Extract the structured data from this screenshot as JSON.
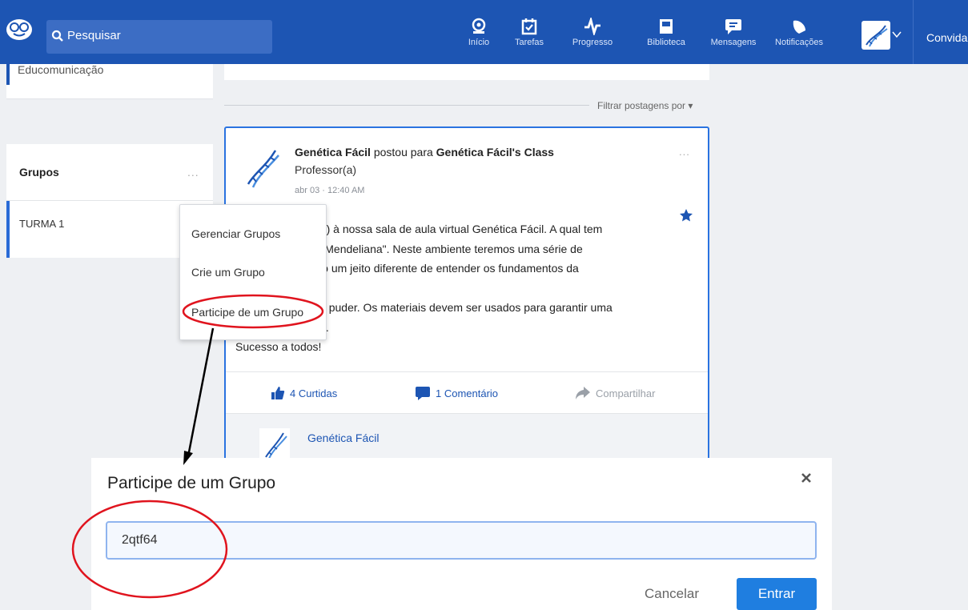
{
  "colors": {
    "brand": "#1d55b3",
    "accent": "#1f7ee0",
    "annotation": "#e0141e"
  },
  "header": {
    "search_label": "Pesquisar",
    "nav": [
      {
        "label": "Início",
        "icon": "apple-home-icon"
      },
      {
        "label": "Tarefas",
        "icon": "calendar-check-icon"
      },
      {
        "label": "Progresso",
        "icon": "pulse-icon"
      },
      {
        "label": "Biblioteca",
        "icon": "book-icon"
      },
      {
        "label": "Mensagens",
        "icon": "chat-icon"
      },
      {
        "label": "Notificações",
        "icon": "bell-icon"
      }
    ],
    "invite_label": "Convida"
  },
  "sidebar": {
    "top_item_label": "Educomunicação",
    "groups_title": "Grupos",
    "groups_more": "...",
    "groups": [
      {
        "label": "TURMA 1"
      }
    ]
  },
  "feed": {
    "filter_label": "Filtrar postagens por ▾"
  },
  "post": {
    "author": "Genética Fácil",
    "action_text": " postou para ",
    "target": "Genética Fácil's Class",
    "role": "Professor(a)",
    "date": "abr 03 · 12:40 AM",
    "more": "...",
    "body_lines": [
      "                    ndo(a) à nossa sala de aula virtual Genética Fácil. A qual tem",
      "                    ética Mendeliana\". Neste ambiente teremos uma série de",
      "                    vendo um jeito diferente de entender os fundamentos da",
      "",
      "                    o que puder. Os materiais devem ser usados para garantir uma",
      "                    agem.",
      "Sucesso a todos!"
    ],
    "likes": "4 Curtidas",
    "comments": "1 Comentário",
    "share": "Compartilhar",
    "comment_author": "Genética Fácil"
  },
  "group_menu": {
    "items": [
      "Gerenciar Grupos",
      "Crie um Grupo",
      "Participe de um Grupo"
    ]
  },
  "modal": {
    "title": "Participe de um Grupo",
    "code_value": "2qtf64",
    "cancel_label": "Cancelar",
    "enter_label": "Entrar"
  }
}
